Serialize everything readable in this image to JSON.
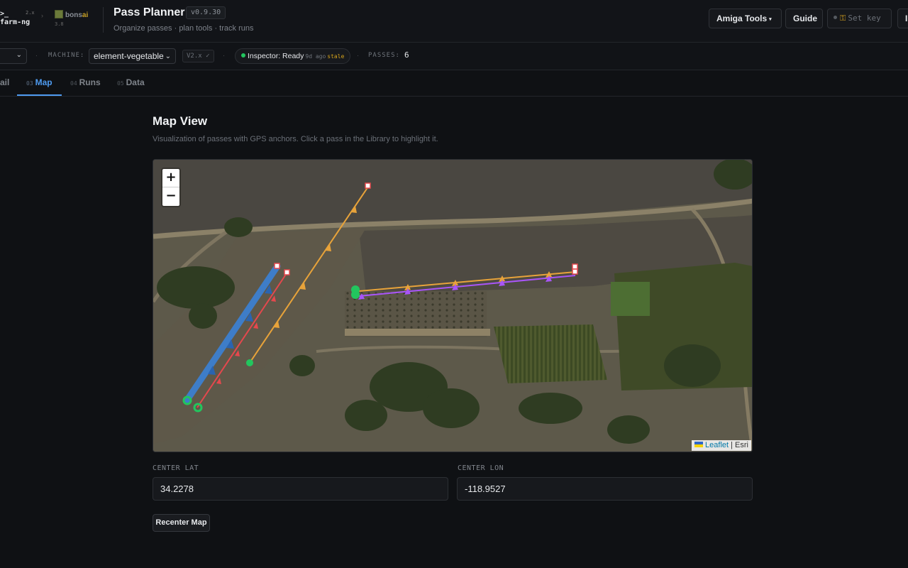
{
  "brand": {
    "farmng_prompt": ">_",
    "farmng_name": "farm-ng",
    "farmng_version": "2.x",
    "bonsai_name_a": "bons",
    "bonsai_name_b": "ai",
    "bonsai_version": "3.8"
  },
  "header": {
    "title": "Pass Planner",
    "version": "v0.9.30",
    "subtitle": "Organize passes · plan tools · track runs",
    "amiga_tools_label": "Amiga Tools",
    "guide_label": "Guide",
    "set_key_label": "Set key",
    "extra_label": "I"
  },
  "machine_bar": {
    "machine_label": "MACHINE:",
    "machine_value": "element-vegetable",
    "version_badge": "V2.x ✓",
    "inspector_status": "Inspector: Ready",
    "inspector_age": "9d ago",
    "inspector_stale": "stale",
    "passes_label": "PASSES:",
    "passes_count": "6"
  },
  "tabs": [
    {
      "num": "",
      "label": "ail",
      "active": false
    },
    {
      "num": "03",
      "label": "Map",
      "active": true
    },
    {
      "num": "04",
      "label": "Runs",
      "active": false
    },
    {
      "num": "05",
      "label": "Data",
      "active": false
    }
  ],
  "main": {
    "title": "Map View",
    "description": "Visualization of passes with GPS anchors. Click a pass in the Library to highlight it.",
    "zoom_in": "+",
    "zoom_out": "−",
    "attribution_link": "Leaflet",
    "attribution_sep": " | ",
    "attribution_source": "Esri",
    "center_lat_label": "CENTER LAT",
    "center_lat_value": "34.2278",
    "center_lon_label": "CENTER LON",
    "center_lon_value": "-118.9527",
    "recenter_label": "Recenter Map"
  },
  "colors": {
    "accent": "#4e9bf0",
    "pass_blue": "#3b82d6",
    "pass_red": "#e5484d",
    "pass_orange": "#e8a33a",
    "pass_purple": "#a855f7",
    "start_marker": "#22c55e",
    "end_marker": "#e5484d"
  },
  "icons": [
    "terminal-icon",
    "bonsai-logo-icon",
    "chevron-down-icon",
    "key-icon",
    "status-dot-icon",
    "zoom-in-icon",
    "zoom-out-icon",
    "leaflet-flag-icon"
  ]
}
